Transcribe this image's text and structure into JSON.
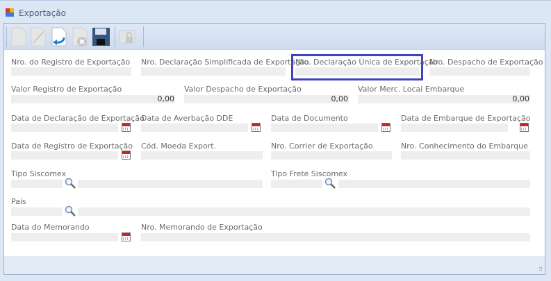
{
  "window": {
    "title": "Exportação"
  },
  "toolbar": {
    "buttons": [
      "new-icon",
      "edit-icon",
      "undo-icon",
      "delete-icon",
      "save-icon",
      "lock-icon"
    ]
  },
  "fields": {
    "nro_registro": {
      "label": "Nro. do Registro de Exportação",
      "value": ""
    },
    "nro_decl_simplificada": {
      "label": "Nro. Declaração Simplificada de Exportação",
      "value": ""
    },
    "nro_decl_unica": {
      "label": "Nro. Declaração Única de Exportação",
      "value": ""
    },
    "nro_despacho": {
      "label": "Nro. Despacho de Exportação",
      "value": ""
    },
    "valor_registro": {
      "label": "Valor Registro de Exportação",
      "value": "0,00"
    },
    "valor_despacho": {
      "label": "Valor Despacho de  Exportação",
      "value": "0,00"
    },
    "valor_merc": {
      "label": "Valor Merc. Local Embarque",
      "value": "0,00"
    },
    "data_declaracao": {
      "label": "Data de Declaração de Exportação",
      "value": ""
    },
    "data_averbacao": {
      "label": "Data de Averbação DDE",
      "value": ""
    },
    "data_documento": {
      "label": "Data de Documento",
      "value": ""
    },
    "data_embarque": {
      "label": "Data de Embarque de Exportação",
      "value": ""
    },
    "data_registro": {
      "label": "Data de Registro de Exportação",
      "value": ""
    },
    "cod_moeda": {
      "label": "Cód. Moeda Export.",
      "value": ""
    },
    "nro_courier": {
      "label": "Nro. Corrier de Exportação",
      "value": ""
    },
    "nro_conhecimento": {
      "label": "Nro. Conhecimento do Embarque",
      "value": ""
    },
    "tipo_siscomex": {
      "label": "Tipo Siscomex",
      "value": ""
    },
    "tipo_frete": {
      "label": "Tipo Frete Siscomex",
      "value": ""
    },
    "pais": {
      "label": "País",
      "value": ""
    },
    "data_memorando": {
      "label": "Data do Memorando",
      "value": ""
    },
    "nro_memorando": {
      "label": "Nro. Memorando de Exportação",
      "value": ""
    }
  },
  "colors": {
    "highlight": "#3e44c0"
  }
}
